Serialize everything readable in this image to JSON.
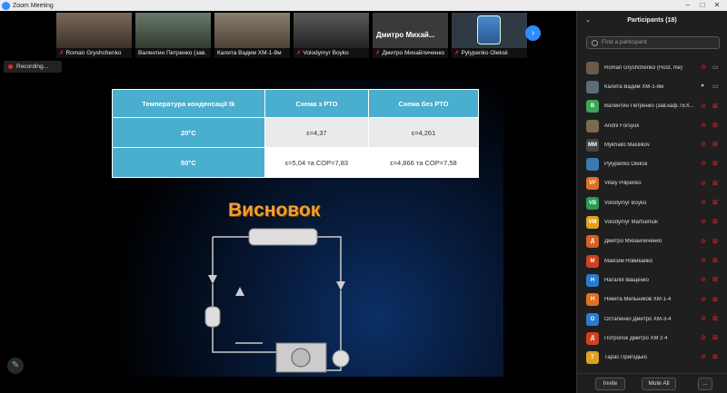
{
  "window": {
    "title": "Zoom Meeting",
    "controls": [
      "–",
      "□",
      "✕"
    ]
  },
  "video_strip": {
    "tiles": [
      {
        "name": "Roman Gryshchenko",
        "muted": true
      },
      {
        "name": "Валентин Петренко (зав.",
        "muted": false
      },
      {
        "name": "Калита Вадим ХМ-1-8м",
        "muted": false
      },
      {
        "name": "Volodymyr Boyko",
        "muted": true
      },
      {
        "name": "Дмитро Михайличенко",
        "muted": true,
        "big_text": "Дмитро  Михай..."
      },
      {
        "name": "Pylypenko Oleksii",
        "muted": true
      }
    ],
    "next_icon": "›"
  },
  "recording": {
    "label": "Recording..."
  },
  "slide": {
    "table": {
      "headers": [
        "Температура конденсації tk",
        "Схема з РТО",
        "Схема без РТО"
      ],
      "rows": [
        {
          "label": "20°С",
          "with": "ε=4,37",
          "without": "ε=4,261"
        },
        {
          "label": "50°С",
          "with": "ε=5,04 та COP=7,83",
          "without": "ε=4,866 та COP=7,58"
        }
      ]
    },
    "heading": "Висновок"
  },
  "participants": {
    "title": "Participants (18)",
    "search_placeholder": "Find a participant",
    "list": [
      {
        "initials": "",
        "name": "Roman Gryshchenko (Host, me)",
        "color": "#6b5a4a",
        "mic": "muted",
        "video": "on"
      },
      {
        "initials": "",
        "name": "Калита Вадим ХМ-1-8м",
        "color": "#5a6b7a",
        "mic": "on",
        "video": "on"
      },
      {
        "initials": "В",
        "name": "Валентин Петренко (зав.каф.ТЕХ...",
        "color": "#3aa655",
        "mic": "muted",
        "video": "off"
      },
      {
        "initials": "",
        "name": "Andrii Forsyuk",
        "color": "#7a6a50",
        "mic": "muted",
        "video": "off"
      },
      {
        "initials": "MM",
        "name": "Mykhailo Masliikov",
        "color": "#444",
        "mic": "muted",
        "video": "off"
      },
      {
        "initials": "",
        "name": "Pylypenko Oleksii",
        "color": "#3a7ab0",
        "mic": "muted",
        "video": "off"
      },
      {
        "initials": "VF",
        "name": "Vitaly Pilipenko",
        "color": "#e07020",
        "mic": "muted",
        "video": "off"
      },
      {
        "initials": "VB",
        "name": "Volodymyr Boyko",
        "color": "#2a9a55",
        "mic": "muted",
        "video": "off"
      },
      {
        "initials": "VM",
        "name": "Volodymyr Martseniuk",
        "color": "#e0a020",
        "mic": "muted",
        "video": "off"
      },
      {
        "initials": "Д",
        "name": "Дмитро Михайличенко",
        "color": "#d86020",
        "mic": "muted",
        "video": "off"
      },
      {
        "initials": "М",
        "name": "Максим Новикайко",
        "color": "#d04020",
        "mic": "muted",
        "video": "off"
      },
      {
        "initials": "Н",
        "name": "Наталія Іващенко",
        "color": "#2a7ad0",
        "mic": "muted",
        "video": "off"
      },
      {
        "initials": "Н",
        "name": "Никита Мельников ХМ-1-4",
        "color": "#e07020",
        "mic": "muted",
        "video": "off"
      },
      {
        "initials": "О",
        "name": "Остапенко Дмитро ХМ-3-4",
        "color": "#2a7ad0",
        "mic": "muted",
        "video": "off"
      },
      {
        "initials": "Д",
        "name": "Потропок Дмитро ХМ 3 4",
        "color": "#d04020",
        "mic": "muted",
        "video": "off"
      },
      {
        "initials": "Т",
        "name": "Тарас Пригодько",
        "color": "#e0a020",
        "mic": "muted",
        "video": "off"
      }
    ],
    "invite_label": "Invite",
    "mute_all_label": "Mute All",
    "more_label": "..."
  }
}
